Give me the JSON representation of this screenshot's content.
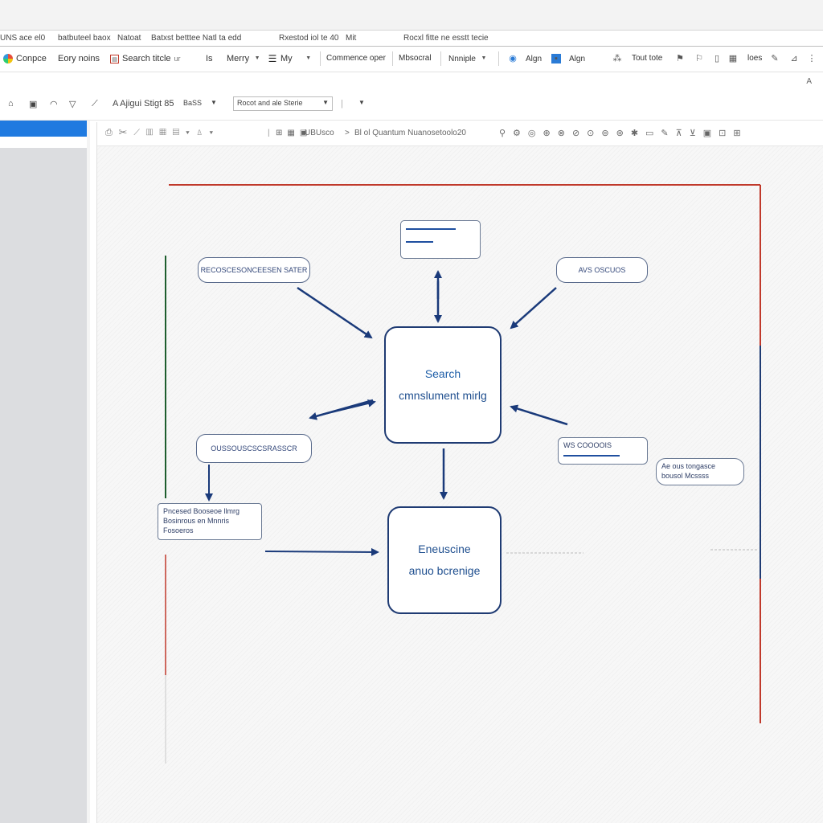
{
  "menu": {
    "items": [
      "UNS ace el0",
      "batbuteel baox",
      "Natoat",
      "Batxst betttee Natl ta edd",
      "Rxestod iol te 40",
      "Mit",
      "Rocxl fitte ne esstt tecie"
    ]
  },
  "ribbon": {
    "compose": "Conpce",
    "eory": "Eory noins",
    "search_title": "Search titcle",
    "search_suffix": "ur",
    "is_label": "Is",
    "merry": "Merry",
    "my": "My",
    "commence": "Commence oper",
    "mbsocral": "Mbsocral",
    "nnniple": "Nnniple",
    "algn": "Algn",
    "align": "Algn",
    "tout": "Tout tote",
    "loes": "loes"
  },
  "toolbar2": {
    "style_label": "A Ajigui Stigt 85",
    "style_suffix": "BaSS",
    "font_select": "Rocot and ale Sterie",
    "corner": "A"
  },
  "canvas_toolbar": {
    "path": "UBUsco",
    "path_sep": ">",
    "path_title": "Bl ol Quantum Nuanosetoolo20"
  },
  "diagram": {
    "center_node": {
      "line1": "Search",
      "line2": "cmnslument mirlg"
    },
    "bottom_node": {
      "line1": "Eneuscine",
      "line2": "anuo bcrenige"
    },
    "bubble_top_left": "RECOSCESONCEESEN SATER",
    "bubble_top_right": "AVS OSCUOS",
    "bubble_mid_left": "OUSSOUSCSCSRASSCR",
    "bubble_mid_right": "WS COOOOIS",
    "note_right": [
      "Ae ous tongasce",
      "bousol Mcssss"
    ],
    "note_left": [
      "Pncesed Booseoe llmrg",
      "Bosinrous en Mnnris",
      "Fosoeros"
    ]
  },
  "colors": {
    "accent": "#1f7ae0",
    "node_border": "#1f3b73",
    "arrow": "#1a3a7a",
    "frame_red": "#c0392b",
    "frame_navy": "#1f3b73",
    "frame_green": "#1e5e2e"
  }
}
